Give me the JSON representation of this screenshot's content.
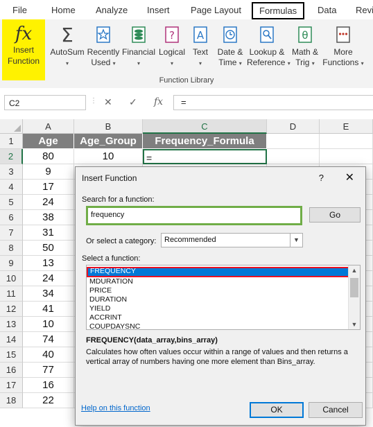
{
  "ribbon": {
    "tabs": [
      "File",
      "Home",
      "Analyze",
      "Insert",
      "Page Layout",
      "Formulas",
      "Data",
      "Revi"
    ],
    "active_tab": "Formulas",
    "insert_function": {
      "line1": "Insert",
      "line2": "Function"
    },
    "buttons": [
      {
        "line1": "AutoSum",
        "line2": ""
      },
      {
        "line1": "Recently",
        "line2": "Used"
      },
      {
        "line1": "Financial",
        "line2": ""
      },
      {
        "line1": "Logical",
        "line2": ""
      },
      {
        "line1": "Text",
        "line2": ""
      },
      {
        "line1": "Date &",
        "line2": "Time"
      },
      {
        "line1": "Lookup &",
        "line2": "Reference"
      },
      {
        "line1": "Math &",
        "line2": "Trig"
      },
      {
        "line1": "More",
        "line2": "Functions"
      }
    ],
    "group_label": "Function Library",
    "accent_color": "#fff200"
  },
  "formula_bar": {
    "name_box": "C2",
    "formula": "="
  },
  "grid": {
    "columns": [
      "A",
      "B",
      "C",
      "D",
      "E"
    ],
    "rows": [
      "1",
      "2",
      "3",
      "4",
      "5",
      "6",
      "7",
      "8",
      "9",
      "10",
      "11",
      "12",
      "13",
      "14",
      "15",
      "16",
      "17",
      "18"
    ],
    "headers": [
      "Age",
      "Age_Group",
      "Frequency_Formula"
    ],
    "ages": [
      "80",
      "9",
      "17",
      "24",
      "38",
      "31",
      "50",
      "13",
      "24",
      "34",
      "41",
      "10",
      "74",
      "40",
      "77",
      "16",
      "22"
    ],
    "age_group_row2": "10",
    "active_cell_value": "=",
    "selection_color": "#217346"
  },
  "dialog": {
    "title": "Insert Function",
    "help": "?",
    "close": "✕",
    "search_label": "Search for a function:",
    "search_value": "frequency",
    "go_label": "Go",
    "category_label": "Or select a category:",
    "category_value": "Recommended",
    "select_label": "Select a function:",
    "functions": [
      "FREQUENCY",
      "MDURATION",
      "PRICE",
      "DURATION",
      "YIELD",
      "ACCRINT",
      "COUPDAYSNC"
    ],
    "selected_function": "FREQUENCY",
    "signature": "FREQUENCY(data_array,bins_array)",
    "description": "Calculates how often values occur within a range of values and then returns a vertical array of numbers having one more element than Bins_array.",
    "help_link": "Help on this function",
    "ok_label": "OK",
    "cancel_label": "Cancel"
  }
}
